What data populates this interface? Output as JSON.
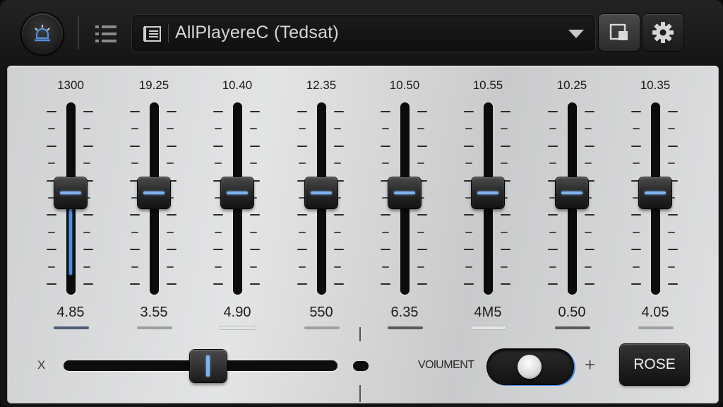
{
  "header": {
    "title": "AllPlayereC (Tedsat)",
    "icons": {
      "home": "alarm-bell-icon",
      "list": "list-icon",
      "title": "document-list-icon",
      "dropdown": "chevron-down-icon",
      "view": "window-icon",
      "settings": "gear-icon"
    }
  },
  "bands": [
    {
      "freq": "1300",
      "value": "4.85",
      "level": 0.5,
      "fill": true,
      "bar": "active"
    },
    {
      "freq": "19.25",
      "value": "3.55",
      "level": 0.5,
      "fill": false,
      "bar": "normal"
    },
    {
      "freq": "10.40",
      "value": "4.90",
      "level": 0.5,
      "fill": false,
      "bar": "light"
    },
    {
      "freq": "12.35",
      "value": "550",
      "level": 0.5,
      "fill": false,
      "bar": "normal"
    },
    {
      "freq": "10.50",
      "value": "6.35",
      "level": 0.5,
      "fill": false,
      "bar": "dark"
    },
    {
      "freq": "10.55",
      "value": "4M5",
      "level": 0.5,
      "fill": false,
      "bar": "light"
    },
    {
      "freq": "10.25",
      "value": "0.50",
      "level": 0.5,
      "fill": false,
      "bar": "dark"
    },
    {
      "freq": "10.35",
      "value": "4.05",
      "level": 0.5,
      "fill": false,
      "bar": "normal"
    }
  ],
  "bottom": {
    "x_label": "X",
    "balance_level": 0.55,
    "volume_label": "VOlUMENT",
    "plus_label": "+",
    "toggle_on": true,
    "button_label": "ROSE"
  },
  "colors": {
    "accent": "#4f8fe0",
    "panel": "#d6d7d8",
    "chrome": "#1a1a1a"
  }
}
